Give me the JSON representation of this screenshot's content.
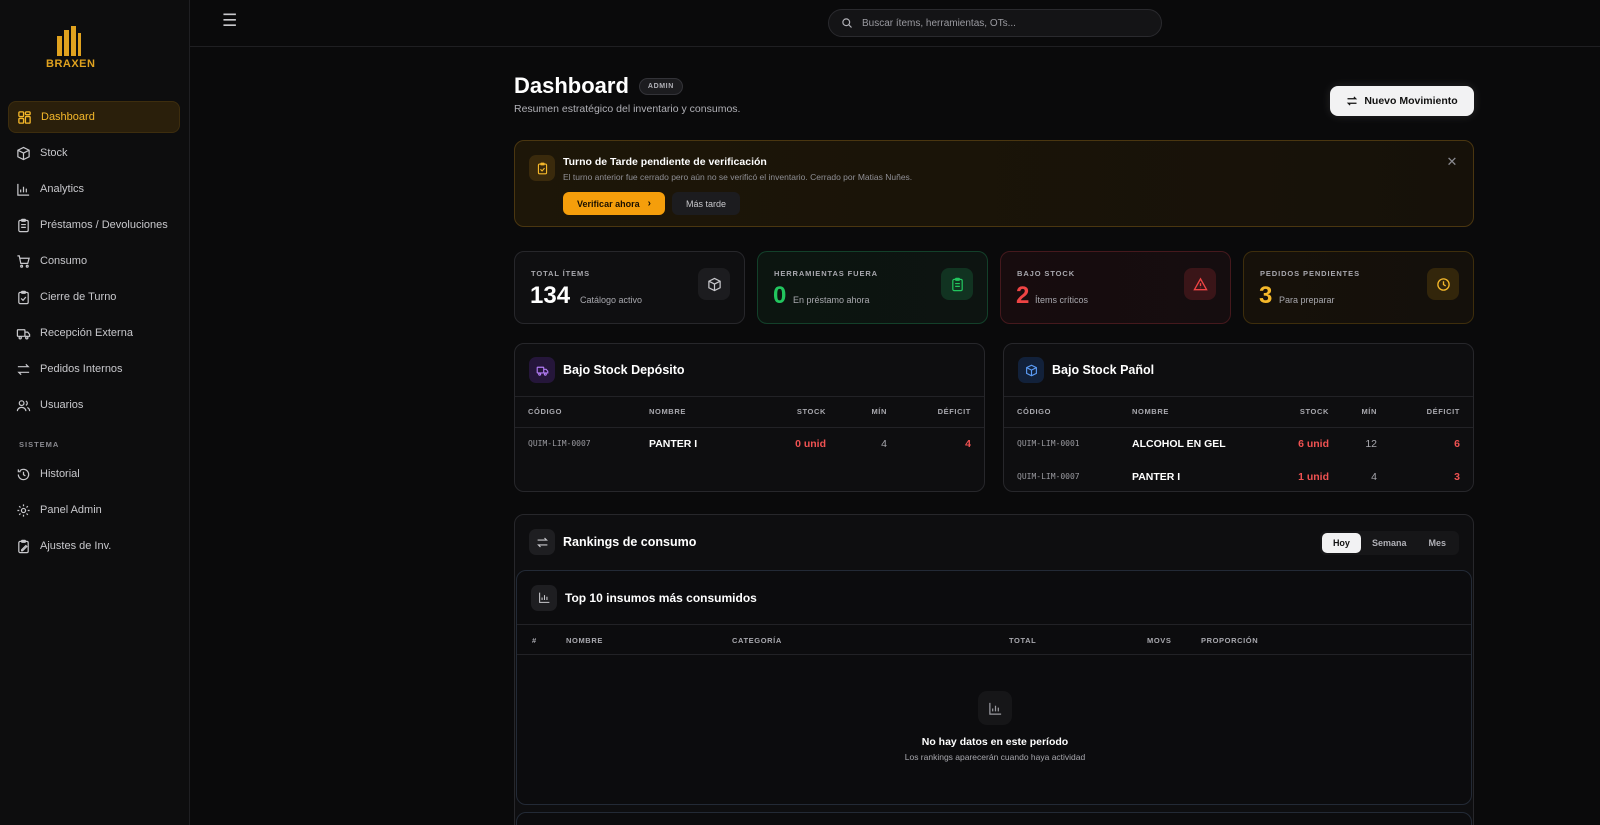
{
  "brand": {
    "name": "BRAXEN",
    "accent": "#e0a21f"
  },
  "sidebar": {
    "items": [
      {
        "label": "Dashboard",
        "icon": "dashboard-icon",
        "active": true
      },
      {
        "label": "Stock",
        "icon": "box-icon"
      },
      {
        "label": "Analytics",
        "icon": "bar-chart-icon"
      },
      {
        "label": "Préstamos / Devoluciones",
        "icon": "clipboard-icon"
      },
      {
        "label": "Consumo",
        "icon": "cart-icon"
      },
      {
        "label": "Cierre de Turno",
        "icon": "clipboard-check-icon"
      },
      {
        "label": "Recepción Externa",
        "icon": "truck-icon"
      },
      {
        "label": "Pedidos Internos",
        "icon": "swap-icon"
      },
      {
        "label": "Usuarios",
        "icon": "users-icon"
      }
    ],
    "section_label": "SISTEMA",
    "system_items": [
      {
        "label": "Historial",
        "icon": "history-icon"
      },
      {
        "label": "Panel Admin",
        "icon": "gear-icon"
      },
      {
        "label": "Ajustes de Inv.",
        "icon": "clipboard-edit-icon"
      }
    ]
  },
  "topbar": {
    "search_placeholder": "Buscar ítems, herramientas, OTs..."
  },
  "header": {
    "title": "Dashboard",
    "badge": "ADMIN",
    "subtitle": "Resumen estratégico del inventario y consumos.",
    "new_movement_label": "Nuevo Movimiento"
  },
  "alert": {
    "title": "Turno de Tarde pendiente de verificación",
    "description": "El turno anterior fue cerrado pero aún no se verificó el inventario. Cerrado por Matias Nuñes.",
    "verify_label": "Verificar ahora",
    "later_label": "Más tarde"
  },
  "stats": [
    {
      "label": "TOTAL ÍTEMS",
      "value": "134",
      "caption": "Catálogo activo",
      "icon": "box-icon"
    },
    {
      "label": "HERRAMIENTAS FUERA",
      "value": "0",
      "caption": "En préstamo ahora",
      "icon": "clipboard-icon"
    },
    {
      "label": "BAJO STOCK",
      "value": "2",
      "caption": "Ítems críticos",
      "icon": "warning-icon"
    },
    {
      "label": "PEDIDOS PENDIENTES",
      "value": "3",
      "caption": "Para preparar",
      "icon": "clock-icon"
    }
  ],
  "deposito": {
    "title": "Bajo Stock Depósito",
    "columns": [
      "CÓDIGO",
      "NOMBRE",
      "STOCK",
      "MÍN",
      "DÉFICIT"
    ],
    "rows": [
      {
        "codigo": "QUIM-LIM-0007",
        "nombre": "PANTER I",
        "stock": "0 unid",
        "min": "4",
        "deficit": "4"
      }
    ]
  },
  "panol": {
    "title": "Bajo Stock Pañol",
    "columns": [
      "CÓDIGO",
      "NOMBRE",
      "STOCK",
      "MÍN",
      "DÉFICIT"
    ],
    "rows": [
      {
        "codigo": "QUIM-LIM-0001",
        "nombre": "ALCOHOL EN GEL",
        "stock": "6 unid",
        "min": "12",
        "deficit": "6"
      },
      {
        "codigo": "QUIM-LIM-0007",
        "nombre": "PANTER I",
        "stock": "1 unid",
        "min": "4",
        "deficit": "3"
      }
    ]
  },
  "rankings": {
    "title": "Rankings de consumo",
    "periods": [
      "Hoy",
      "Semana",
      "Mes"
    ],
    "active_period": "Hoy",
    "top": {
      "title": "Top 10 insumos más consumidos",
      "columns": [
        "#",
        "NOMBRE",
        "CATEGORÍA",
        "TOTAL",
        "MOVS",
        "PROPORCIÓN"
      ],
      "empty_title": "No hay datos en este período",
      "empty_sub": "Los rankings aparecerán cuando haya actividad"
    }
  }
}
